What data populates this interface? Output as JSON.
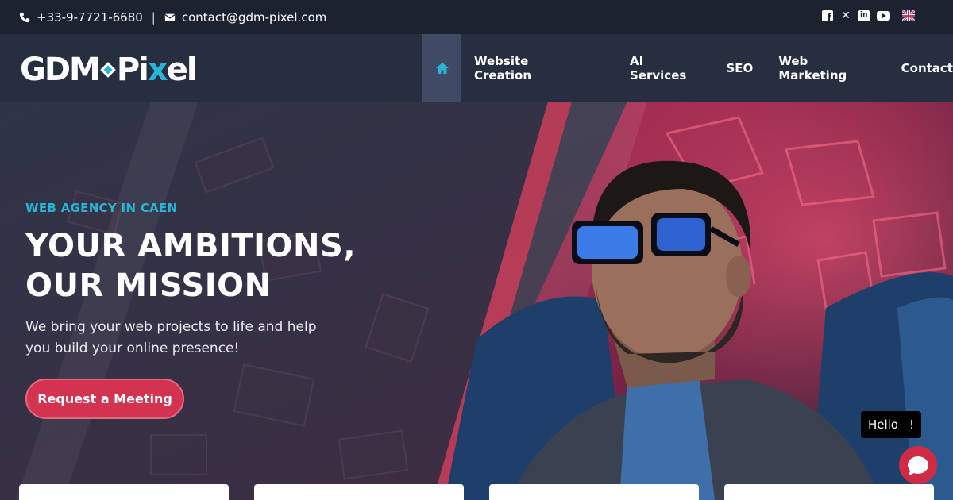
{
  "topbar": {
    "phone": "+33-9-7721-6680",
    "separator": "|",
    "email": "contact@gdm-pixel.com",
    "phone_icon": "phone-icon",
    "email_icon": "envelope-icon",
    "socials": [
      "facebook-icon",
      "x-icon",
      "linkedin-icon",
      "youtube-icon"
    ],
    "language_icon": "uk-flag-icon"
  },
  "logo": {
    "part1": "GDM",
    "part2": "Pi",
    "part3": "x",
    "part4": "el"
  },
  "nav": {
    "home_icon": "home-icon",
    "items": [
      "Website Creation",
      "AI Services",
      "SEO",
      "Web Marketing",
      "Contact"
    ]
  },
  "hero": {
    "eyebrow": "WEB AGENCY IN CAEN",
    "headline_line1": "YOUR AMBITIONS,",
    "headline_line2": "OUR MISSION",
    "subtext": "We bring your web projects to life and help you build your online presence!",
    "cta": "Request a Meeting"
  },
  "chat": {
    "greeting": "Hello",
    "greeting_suffix": "!",
    "icon": "chat-bubble-icon"
  },
  "colors": {
    "accent": "#29b6d6",
    "brand_red": "#d4334f",
    "nav_bg": "#262e40",
    "topbar_bg": "#1d2230"
  }
}
